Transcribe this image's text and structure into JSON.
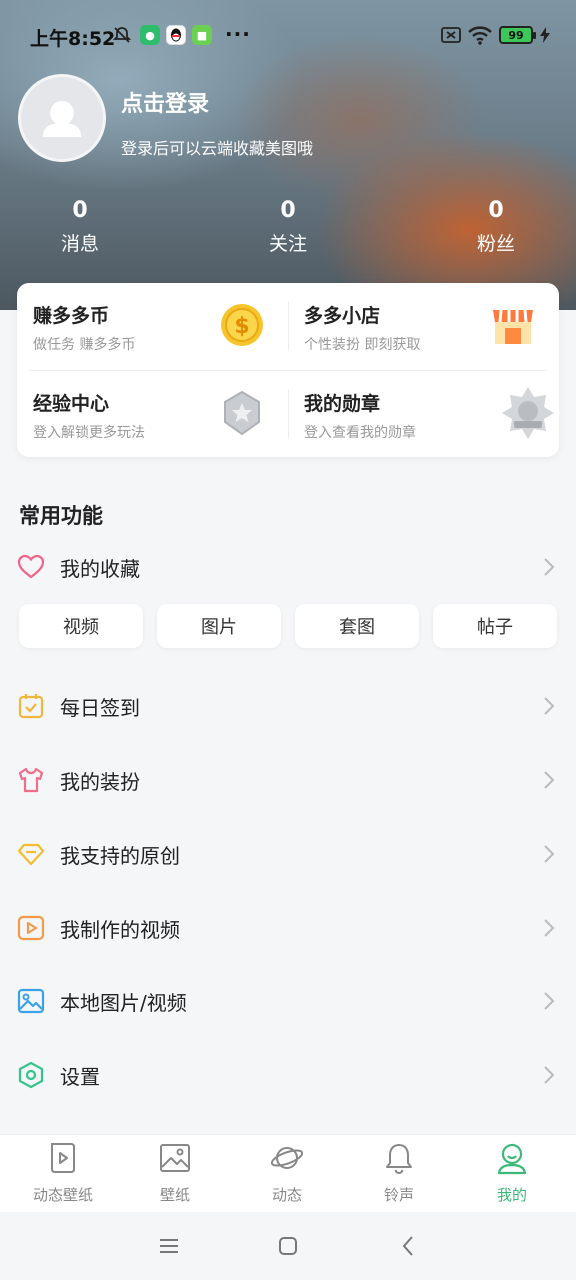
{
  "status_bar": {
    "time": "上午8:52",
    "battery": "99",
    "more": "···"
  },
  "profile": {
    "title": "点击登录",
    "subtitle": "登录后可以云端收藏美图哦",
    "stats": [
      {
        "value": "0",
        "label": "消息"
      },
      {
        "value": "0",
        "label": "关注"
      },
      {
        "value": "0",
        "label": "粉丝"
      }
    ]
  },
  "cards": [
    {
      "title": "赚多多币",
      "subtitle": "做任务 赚多多币",
      "icon": "coin-icon"
    },
    {
      "title": "多多小店",
      "subtitle": "个性装扮 即刻获取",
      "icon": "shop-icon"
    },
    {
      "title": "经验中心",
      "subtitle": "登入解锁更多玩法",
      "icon": "star-badge-icon"
    },
    {
      "title": "我的勋章",
      "subtitle": "登入查看我的勋章",
      "icon": "medal-icon"
    }
  ],
  "common": {
    "title": "常用功能",
    "favorites": {
      "label": "我的收藏",
      "icon": "heart-icon"
    },
    "favorite_tabs": [
      "视频",
      "图片",
      "套图",
      "帖子"
    ],
    "items": [
      {
        "label": "每日签到",
        "icon": "calendar-check-icon"
      },
      {
        "label": "我的装扮",
        "icon": "tshirt-icon"
      },
      {
        "label": "我支持的原创",
        "icon": "diamond-icon"
      },
      {
        "label": "我制作的视频",
        "icon": "video-play-icon"
      },
      {
        "label": "本地图片/视频",
        "icon": "image-icon"
      },
      {
        "label": "设置",
        "icon": "settings-hexagon-icon"
      }
    ]
  },
  "bottom_nav": [
    {
      "label": "动态壁纸",
      "icon": "live-wallpaper-icon"
    },
    {
      "label": "壁纸",
      "icon": "wallpaper-icon"
    },
    {
      "label": "动态",
      "icon": "planet-icon"
    },
    {
      "label": "铃声",
      "icon": "bell-icon"
    },
    {
      "label": "我的",
      "icon": "profile-icon",
      "active": true
    }
  ],
  "colors": {
    "accent": "#3bb978",
    "card_bg": "#ffffff",
    "page_bg": "#f5f6f8"
  }
}
